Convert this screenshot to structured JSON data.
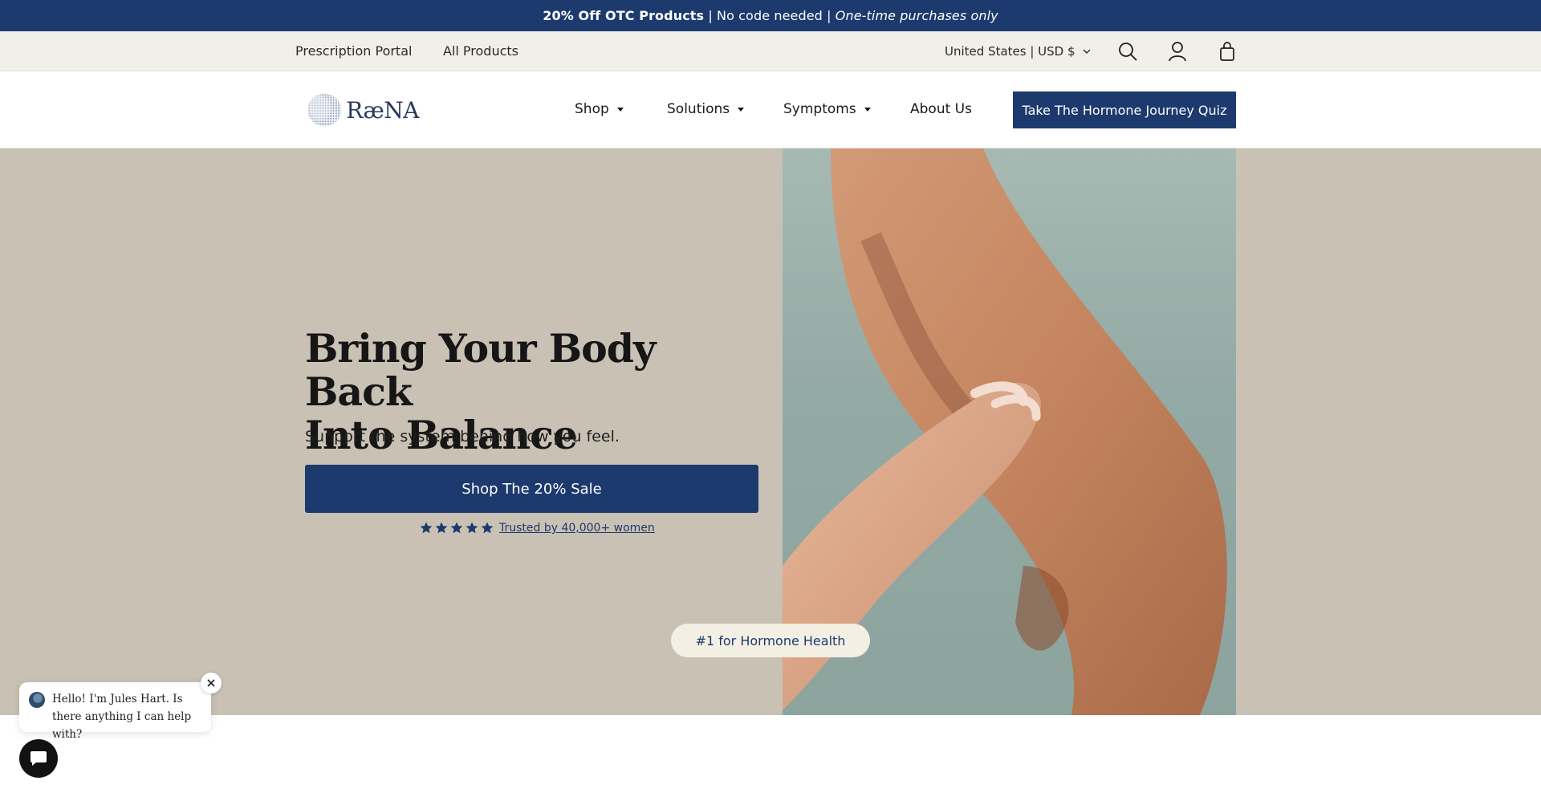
{
  "announcement": {
    "bold": "20% Off OTC Products",
    "middle": " | No code needed | ",
    "italic": "One-time purchases only"
  },
  "utility_bar": {
    "links": [
      "Prescription Portal",
      "All Products"
    ],
    "region": "United States | USD $",
    "icons": [
      "search-icon",
      "account-icon",
      "cart-icon"
    ]
  },
  "header": {
    "logo_text": "RæNA",
    "nav": [
      {
        "label": "Shop",
        "has_dropdown": true
      },
      {
        "label": "Solutions",
        "has_dropdown": true
      },
      {
        "label": "Symptoms",
        "has_dropdown": true
      },
      {
        "label": "About Us",
        "has_dropdown": false
      }
    ],
    "quiz_button": "Take The Hormone Journey Quiz"
  },
  "hero": {
    "title_line1": "Bring Your Body Back",
    "title_line2": "Into Balance",
    "subtitle": "Support the system behind how you feel.",
    "cta": "Shop The 20% Sale",
    "rating_stars": 5,
    "rating_link": "Trusted by 40,000+ women",
    "badge": "#1 for Hormone Health"
  },
  "chat": {
    "message": "Hello! I'm Jules Hart. Is there anything I can help with?"
  },
  "colors": {
    "brand_navy": "#1d3a6e",
    "hero_bg": "#c9c1b4",
    "utility_bg": "#f1efe9"
  }
}
